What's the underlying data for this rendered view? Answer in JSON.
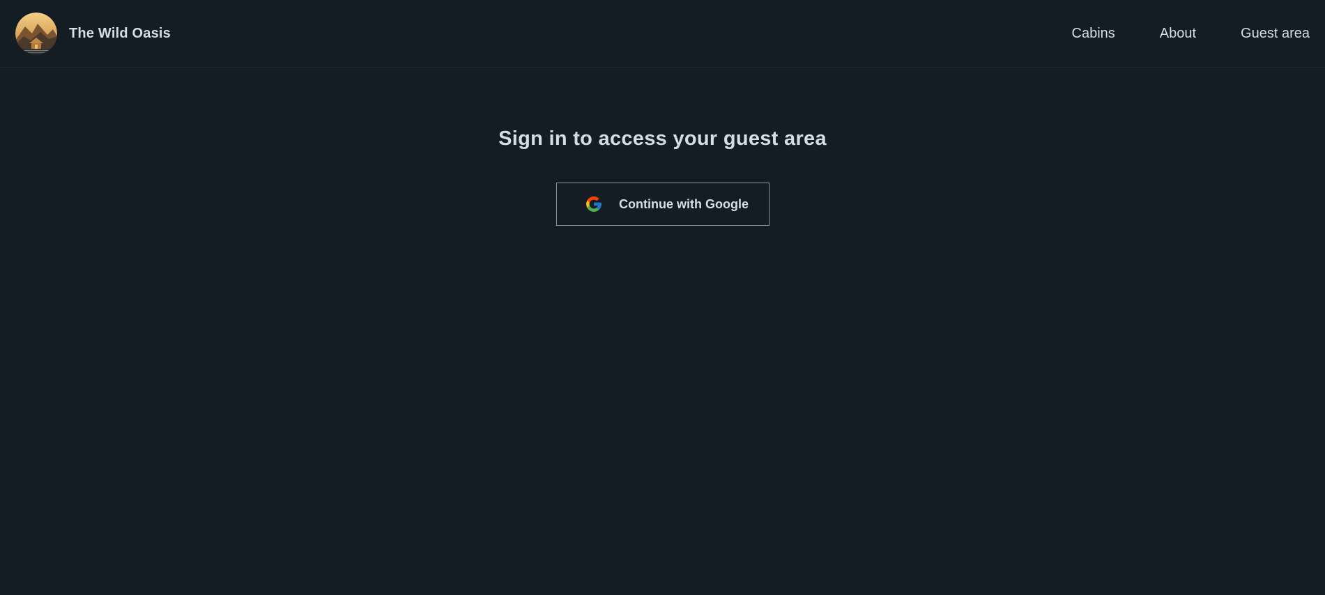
{
  "header": {
    "brand_name": "The Wild Oasis",
    "logo_icon": "cabin-mountain-logo",
    "nav": [
      {
        "label": "Cabins"
      },
      {
        "label": "About"
      },
      {
        "label": "Guest area"
      }
    ]
  },
  "main": {
    "title": "Sign in to access your guest area",
    "google_button_label": "Continue with Google",
    "google_icon": "google-g-icon"
  },
  "colors": {
    "background": "#141c24",
    "text": "#d4dee7",
    "button_border": "#8c9bab",
    "accent_gold": "#d2a55a"
  }
}
